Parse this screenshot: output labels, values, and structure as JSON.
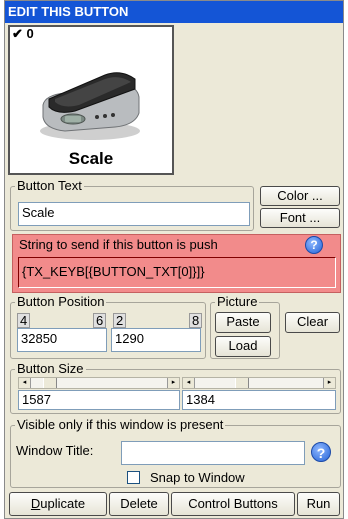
{
  "title": "EDIT THIS BUTTON",
  "preview": {
    "count": "✔ 0",
    "label": "Scale",
    "image_name": "scale-image"
  },
  "button_text": {
    "legend": "Button Text",
    "value": "Scale",
    "color_label": "Color ...",
    "font_label": "Font ..."
  },
  "push_string": {
    "legend": "String to send if this button is push",
    "value": "{TX_KEYB[{BUTTON_TXT[0]}]}",
    "help": "?"
  },
  "button_position": {
    "legend": "Button Position",
    "n1": "4",
    "n2": "6",
    "n3": "2",
    "n4": "8",
    "x_value": "32850",
    "y_value": "1290"
  },
  "picture": {
    "legend": "Picture",
    "paste_label": "Paste",
    "clear_label": "Clear",
    "load_label": "Load"
  },
  "button_size": {
    "legend": "Button Size",
    "width_value": "1587",
    "height_value": "1384",
    "width_slider": 0.1,
    "height_slider": 0.35
  },
  "visibility": {
    "legend": "Visible only if this window is present",
    "window_title_label": "Window Title:",
    "window_title_value": "",
    "help": "?",
    "snap_label": "Snap to Window",
    "snap_checked": false
  },
  "actions": {
    "duplicate_label": "Duplicate",
    "delete_label": "Delete",
    "control_buttons_label": "Control Buttons",
    "run_label": "Run"
  },
  "colors": {
    "title_bar": "#1455d6",
    "push_section": "#f28b8b"
  }
}
